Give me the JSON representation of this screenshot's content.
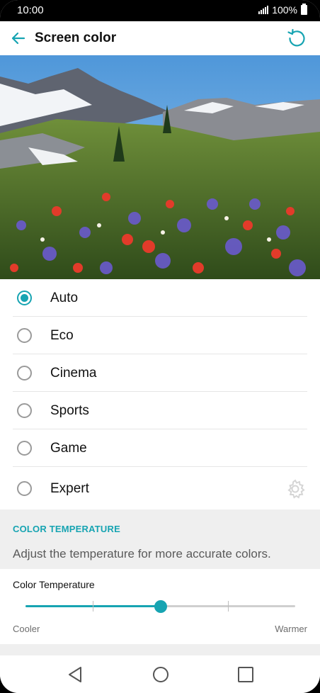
{
  "status_bar": {
    "time": "10:00",
    "battery": "100%",
    "icons": [
      "signal-icon",
      "battery-icon"
    ]
  },
  "app_bar": {
    "title": "Screen color",
    "back_icon": "arrow-left-icon",
    "reset_icon": "reset-icon"
  },
  "hero_image": {
    "description_icon": "landscape-preview-image"
  },
  "options": [
    {
      "label": "Auto",
      "selected": true
    },
    {
      "label": "Eco",
      "selected": false
    },
    {
      "label": "Cinema",
      "selected": false
    },
    {
      "label": "Sports",
      "selected": false
    },
    {
      "label": "Game",
      "selected": false
    },
    {
      "label": "Expert",
      "selected": false,
      "icon": "gear-icon"
    }
  ],
  "color_temperature": {
    "section_header": "COLOR TEMPERATURE",
    "description": "Adjust the temperature for more accurate colors.",
    "slider_label": "Color Temperature",
    "min_label": "Cooler",
    "max_label": "Warmer",
    "value_fraction": 0.5,
    "tick_fractions": [
      0.25,
      0.5,
      0.75
    ]
  },
  "colors": {
    "accent": "#17a4b2",
    "section_bg": "#efefef",
    "text_primary": "#111111",
    "text_secondary": "#5a5a5a"
  },
  "nav_bar": {
    "icons": [
      "back-triangle-icon",
      "home-circle-icon",
      "recents-square-icon"
    ]
  }
}
